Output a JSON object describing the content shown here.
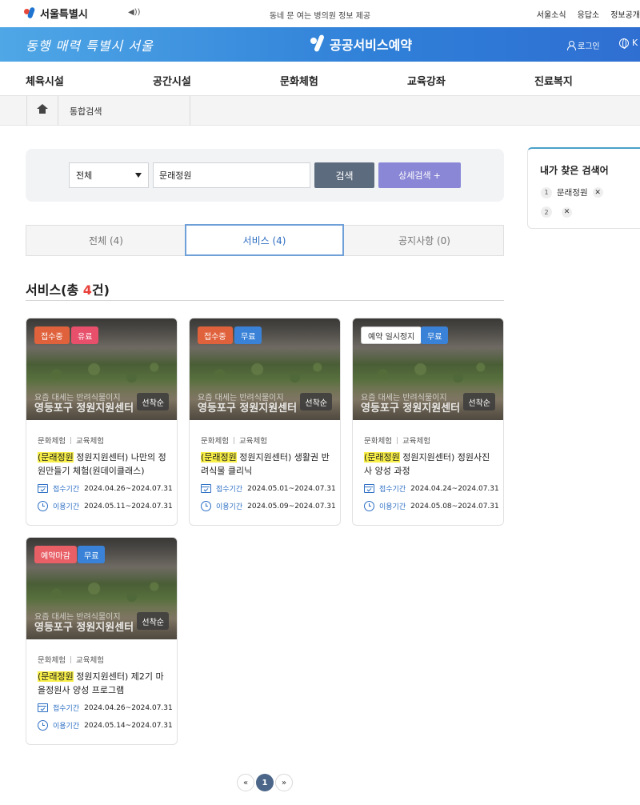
{
  "topbar": {
    "logo_text": "서울특별시",
    "speaker_icon": "speaker-icon",
    "notice": "동네 문 여는 병의원 정보 제공",
    "links": [
      "서울소식",
      "응답소",
      "정보공개"
    ]
  },
  "brand": {
    "slogan": "동행 매력 특별시 서울",
    "title": "공공서비스예약",
    "login": "로그인",
    "lang": "K"
  },
  "nav": {
    "items": [
      "체육시설",
      "공간시설",
      "문화체험",
      "교육강좌",
      "진료복지"
    ]
  },
  "breadcrumb": {
    "current": "통합검색"
  },
  "search": {
    "select_value": "전체",
    "query": "문래정원",
    "search_label": "검색",
    "detail_label": "상세검색",
    "detail_plus": "+"
  },
  "tabs": [
    {
      "label": "전체 (4)"
    },
    {
      "label": "서비스 (4)"
    },
    {
      "label": "공지사항 (0)"
    }
  ],
  "section": {
    "prefix": "서비스(총 ",
    "count": "4",
    "suffix": "건)"
  },
  "cards": [
    {
      "badges": [
        "접수중",
        "유료"
      ],
      "overlay_line1": "요즘 대세는 반려식물이지",
      "overlay_line2": "영등포구 정원지원센터",
      "first_come": "선착순",
      "cat1": "문화체험",
      "cat2": "교육체험",
      "highlight": "(문래정원",
      "title_rest": " 정원지원센터) 나만의 정원만들기 체험(원데이클래스)",
      "reg_label": "접수기간",
      "reg_period": "2024.04.26~2024.07.31",
      "use_label": "이용기간",
      "use_period": "2024.05.11~2024.07.31"
    },
    {
      "badges": [
        "접수중",
        "무료"
      ],
      "overlay_line1": "요즘 대세는 반려식물이지",
      "overlay_line2": "영등포구 정원지원센터",
      "first_come": "선착순",
      "cat1": "문화체험",
      "cat2": "교육체험",
      "highlight": "(문래정원",
      "title_rest": " 정원지원센터) 생활권 반려식물 클리닉",
      "reg_label": "접수기간",
      "reg_period": "2024.05.01~2024.07.31",
      "use_label": "이용기간",
      "use_period": "2024.05.09~2024.07.31"
    },
    {
      "badges": [
        "예약 일시정지",
        "무료"
      ],
      "overlay_line1": "요즘 대세는 반려식물이지",
      "overlay_line2": "영등포구 정원지원센터",
      "first_come": "선착순",
      "cat1": "문화체험",
      "cat2": "교육체험",
      "highlight": "(문래정원",
      "title_rest": " 정원지원센터) 정원사진사 양성 과정",
      "reg_label": "접수기간",
      "reg_period": "2024.04.24~2024.07.31",
      "use_label": "이용기간",
      "use_period": "2024.05.08~2024.07.31"
    },
    {
      "badges": [
        "예약마감",
        "무료"
      ],
      "overlay_line1": "요즘 대세는 반려식물이지",
      "overlay_line2": "영등포구 정원지원센터",
      "first_come": "선착순",
      "cat1": "문화체험",
      "cat2": "교육체험",
      "highlight": "(문래정원",
      "title_rest": " 정원지원센터) 제2기 마을정원사 양성 프로그램",
      "reg_label": "접수기간",
      "reg_period": "2024.04.26~2024.07.31",
      "use_label": "이용기간",
      "use_period": "2024.05.14~2024.07.31"
    }
  ],
  "pagination": {
    "prev": "«",
    "current": "1",
    "next": "»"
  },
  "recent": {
    "title": "내가 찾은 검색어",
    "items": [
      {
        "num": "1",
        "text": "문래정원",
        "x": "✕"
      },
      {
        "num": "2",
        "text": "",
        "x": "✕"
      }
    ]
  }
}
